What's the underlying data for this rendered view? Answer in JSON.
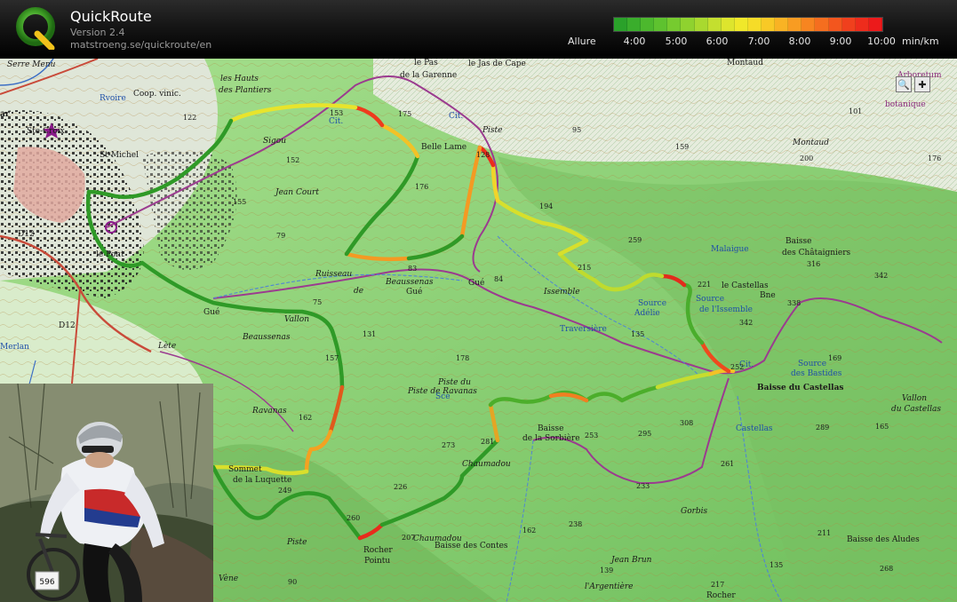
{
  "header": {
    "title": "QuickRoute",
    "version": "Version 2.4",
    "url": "matstroeng.se/quickroute/en",
    "logo_letter": "Q"
  },
  "legend": {
    "label": "Allure",
    "ticks": [
      "4:00",
      "5:00",
      "6:00",
      "7:00",
      "8:00",
      "9:00",
      "10:00"
    ],
    "unit": "min/km",
    "colors": [
      "#2aa12a",
      "#3aad2c",
      "#4cb82d",
      "#5ec22f",
      "#76cb2f",
      "#8fd22f",
      "#a9d92f",
      "#c4df2f",
      "#dde52d",
      "#f0e82a",
      "#f6dc28",
      "#f8c926",
      "#f9b324",
      "#f89c22",
      "#f78520",
      "#f56e1f",
      "#f3561e",
      "#f0401d",
      "#ee2c1c",
      "#ec1a1b"
    ]
  },
  "map": {
    "zoom_tool_glyphs": {
      "magnifier": "🔍",
      "pan": "✚"
    },
    "labels": [
      {
        "text": "Serre Menu",
        "style": "italic"
      },
      {
        "text": "ar",
        "style": "bold"
      },
      {
        "text": "Ste-Croix",
        "style": ""
      },
      {
        "text": "St-Michel",
        "style": ""
      },
      {
        "text": "Rvoire",
        "style": "blue"
      },
      {
        "text": "Coop. vinic.",
        "style": ""
      },
      {
        "text": "les Hauts",
        "style": "italic"
      },
      {
        "text": "des Plantiers",
        "style": "italic"
      },
      {
        "text": "Sigou",
        "style": "italic"
      },
      {
        "text": "Jean Court",
        "style": "italic"
      },
      {
        "text": "le Pas",
        "style": ""
      },
      {
        "text": "de la Garenne",
        "style": ""
      },
      {
        "text": "le Jas de Cape",
        "style": ""
      },
      {
        "text": "Montaud",
        "style": ""
      },
      {
        "text": "Arboretum",
        "style": "purple"
      },
      {
        "text": "botanique",
        "style": "purple"
      },
      {
        "text": "Belle Lame",
        "style": ""
      },
      {
        "text": "Piste",
        "style": "italic"
      },
      {
        "text": "Montaud",
        "style": "italic"
      },
      {
        "text": "Malaigue",
        "style": "blue"
      },
      {
        "text": "Baisse",
        "style": ""
      },
      {
        "text": "des Châtaigniers",
        "style": ""
      },
      {
        "text": "le Castellas",
        "style": ""
      },
      {
        "text": "Bne",
        "style": ""
      },
      {
        "text": "Source",
        "style": "blue"
      },
      {
        "text": "Adélie",
        "style": "blue"
      },
      {
        "text": "Source",
        "style": "blue"
      },
      {
        "text": "de l'Issemble",
        "style": "blue"
      },
      {
        "text": "Baisse du Castellas",
        "style": "bold"
      },
      {
        "text": "Source",
        "style": "blue"
      },
      {
        "text": "des Bastides",
        "style": "blue"
      },
      {
        "text": "Vallon",
        "style": "italic"
      },
      {
        "text": "du Castellas",
        "style": "italic"
      },
      {
        "text": "Ruisseau",
        "style": "italic"
      },
      {
        "text": "de",
        "style": "italic"
      },
      {
        "text": "Beaussenas",
        "style": "italic"
      },
      {
        "text": "Gué",
        "style": ""
      },
      {
        "text": "Gué",
        "style": ""
      },
      {
        "text": "Gué",
        "style": ""
      },
      {
        "text": "Vallon",
        "style": "italic"
      },
      {
        "text": "Beaussenas",
        "style": "italic"
      },
      {
        "text": "Lète",
        "style": "italic"
      },
      {
        "text": "le Pont",
        "style": ""
      },
      {
        "text": "Ravanas",
        "style": "italic"
      },
      {
        "text": "Piste de Ravanas",
        "style": "italic"
      },
      {
        "text": "Piste du",
        "style": "italic"
      },
      {
        "text": "Baisse",
        "style": ""
      },
      {
        "text": "de la Sorbière",
        "style": ""
      },
      {
        "text": "Chaumadou",
        "style": "italic"
      },
      {
        "text": "Chaumadou",
        "style": "italic"
      },
      {
        "text": "Sce",
        "style": "blue"
      },
      {
        "text": "Sommet",
        "style": ""
      },
      {
        "text": "de la Luquette",
        "style": ""
      },
      {
        "text": "Piste",
        "style": "italic"
      },
      {
        "text": "Rocher",
        "style": ""
      },
      {
        "text": "Pointu",
        "style": ""
      },
      {
        "text": "Baisse des Contes",
        "style": ""
      },
      {
        "text": "Jean Brun",
        "style": "italic"
      },
      {
        "text": "Baisse des Aludes",
        "style": ""
      },
      {
        "text": "Vène",
        "style": "italic"
      },
      {
        "text": "Issemble",
        "style": "italic"
      },
      {
        "text": "Traversière",
        "style": "blue"
      },
      {
        "text": "Gorbis",
        "style": "italic"
      },
      {
        "text": "Castellas",
        "style": "blue"
      },
      {
        "text": "l'Argentière",
        "style": "italic"
      },
      {
        "text": "Rocher",
        "style": ""
      },
      {
        "text": "D12",
        "style": ""
      },
      {
        "text": "D12",
        "style": ""
      },
      {
        "text": "Merlan",
        "style": "blue"
      },
      {
        "text": "Cit.",
        "style": "blue"
      },
      {
        "text": "Cit.",
        "style": "blue"
      },
      {
        "text": "Cit.",
        "style": "blue"
      }
    ],
    "elevations": [
      "153",
      "175",
      "122",
      "152",
      "155",
      "79",
      "83",
      "176",
      "128",
      "95",
      "159",
      "101",
      "176",
      "200",
      "194",
      "259",
      "215",
      "316",
      "342",
      "342",
      "338",
      "221",
      "135",
      "178",
      "131",
      "157",
      "162",
      "169",
      "289",
      "165",
      "273",
      "281",
      "253",
      "295",
      "308",
      "252",
      "261",
      "233",
      "226",
      "260",
      "207",
      "249",
      "162",
      "238",
      "139",
      "211",
      "268",
      "135",
      "217",
      "90",
      "75",
      "84"
    ]
  },
  "photo": {
    "bib_number": "596"
  }
}
